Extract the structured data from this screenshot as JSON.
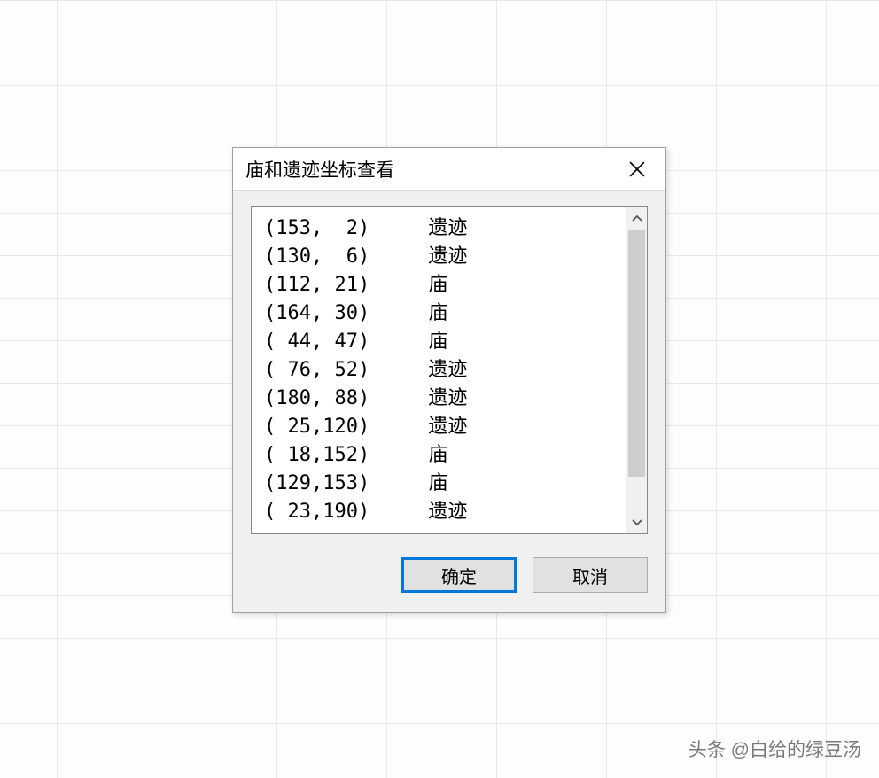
{
  "dialog": {
    "title": "庙和遗迹坐标查看",
    "rows": [
      {
        "coord": "(153,  2)",
        "type": "遗迹"
      },
      {
        "coord": "(130,  6)",
        "type": "遗迹"
      },
      {
        "coord": "(112, 21)",
        "type": "庙"
      },
      {
        "coord": "(164, 30)",
        "type": "庙"
      },
      {
        "coord": "( 44, 47)",
        "type": "庙"
      },
      {
        "coord": "( 76, 52)",
        "type": "遗迹"
      },
      {
        "coord": "(180, 88)",
        "type": "遗迹"
      },
      {
        "coord": "( 25,120)",
        "type": "遗迹"
      },
      {
        "coord": "( 18,152)",
        "type": "庙"
      },
      {
        "coord": "(129,153)",
        "type": "庙"
      },
      {
        "coord": "( 23,190)",
        "type": "遗迹"
      }
    ],
    "buttons": {
      "ok": "确定",
      "cancel": "取消"
    }
  },
  "watermark": "头条 @白给的绿豆汤"
}
